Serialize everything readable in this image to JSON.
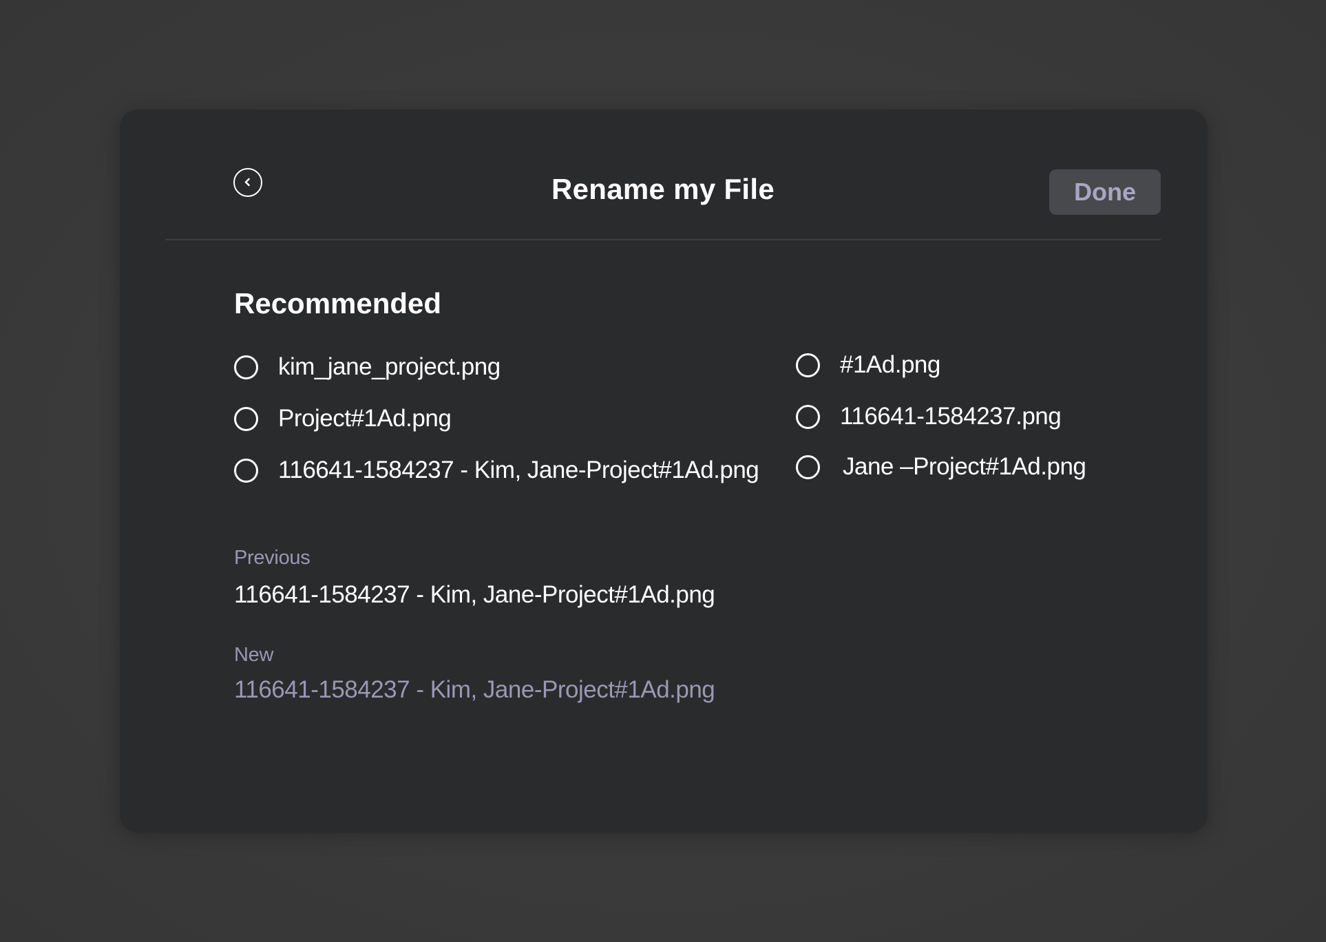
{
  "dialog": {
    "title": "Rename my File",
    "done_label": "Done"
  },
  "recommended": {
    "heading": "Recommended",
    "options": [
      "kim_jane_project.png",
      "Project#1Ad.png",
      "116641-1584237 - Kim, Jane-Project#1Ad.png",
      "#1Ad.png",
      "116641-1584237.png",
      "Jane –Project#1Ad.png"
    ]
  },
  "previous": {
    "label": "Previous",
    "value": "116641-1584237 - Kim, Jane-Project#1Ad.png"
  },
  "new": {
    "label": "New",
    "value": "116641-1584237 - Kim, Jane-Project#1Ad.png"
  },
  "colors": {
    "background": "#3a3a3a",
    "dialog": "#2a2b2d",
    "accent_muted": "#9b97b3",
    "done_bg": "#48494c",
    "text": "#ffffff"
  },
  "icons": {
    "back": "chevron-left-circle-icon",
    "radio": "radio-unselected-icon"
  }
}
